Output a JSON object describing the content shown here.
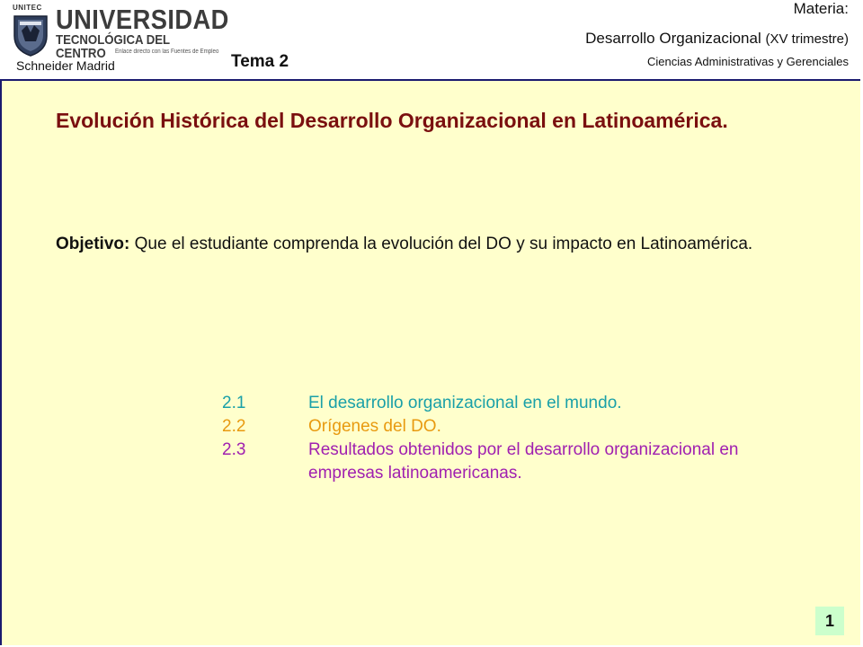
{
  "header": {
    "logo": {
      "small_text": "UNITEC",
      "name_line1": "UNIVERSIDAD",
      "name_line2": "TECNOLÓGICA DEL CENTRO",
      "tagline": "Enlace directo con las Fuentes de Empleo"
    },
    "author": "Schneider Madrid",
    "tema": "Tema 2",
    "materia_label": "Materia:",
    "course_name": "Desarrollo Organizacional",
    "course_term": "(XV trimestre)",
    "department": "Ciencias Administrativas y Gerenciales"
  },
  "colors": {
    "content_bg": "#ffffcc",
    "title": "#7a0f0f",
    "topic_1": "#1aa0a8",
    "topic_2": "#e89a10",
    "topic_3": "#a020b0",
    "page_badge": "#ccffcc",
    "frame": "#1a1a6e"
  },
  "content": {
    "title": "Evolución Histórica del Desarrollo Organizacional en Latinoamérica.",
    "objective_label": "Objetivo:",
    "objective_text": " Que el estudiante comprenda la evolución del DO y su impacto en Latinoamérica.",
    "topics": [
      {
        "number": "2.1",
        "text": "El desarrollo organizacional en el mundo."
      },
      {
        "number": "2.2",
        "text": "Orígenes del DO."
      },
      {
        "number": "2.3",
        "text": "Resultados obtenidos por el desarrollo organizacional en empresas latinoamericanas."
      }
    ]
  },
  "page_number": "1"
}
